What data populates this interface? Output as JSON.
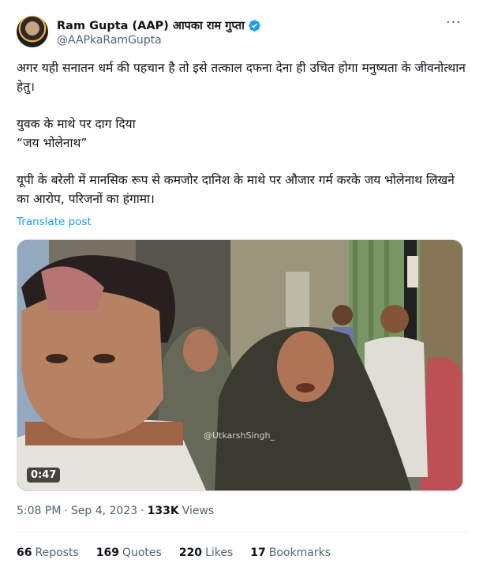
{
  "author": {
    "display_name": "Ram Gupta (AAP) आपका राम गुप्ता",
    "handle": "@AAPkaRamGupta",
    "verified": true,
    "avatar_icon": "profile-avatar"
  },
  "more_icon": "more-horizontal-icon",
  "tweet": {
    "lines": [
      "अगर यही सनातन धर्म की पहचान है तो इसे तत्काल दफना देना ही उचित होगा मनुष्यता के जीवनोत्थान हेतु।",
      "युवक के माथे पर दाग दिया",
      "“जय भोलेनाथ”",
      "यूपी के बरेली में मानसिक रूप से कमजोर दानिश के माथे पर औजार गर्म करके जय भोलेनाथ लिखने का आरोप, परिजनों का हंगामा।"
    ],
    "translate_label": "Translate post"
  },
  "media": {
    "duration": "0:47",
    "watermark": "@UtkarshSingh_"
  },
  "meta": {
    "time": "5:08 PM",
    "date": "Sep 4, 2023",
    "views_count": "133K",
    "views_label": "Views"
  },
  "stats": {
    "reposts_count": "66",
    "reposts_label": "Reposts",
    "quotes_count": "169",
    "quotes_label": "Quotes",
    "likes_count": "220",
    "likes_label": "Likes",
    "bookmarks_count": "17",
    "bookmarks_label": "Bookmarks"
  },
  "colors": {
    "link": "#1d9bf0",
    "secondary_text": "#536471",
    "primary_text": "#0f1419",
    "verified_badge": "#1d9bf0"
  }
}
